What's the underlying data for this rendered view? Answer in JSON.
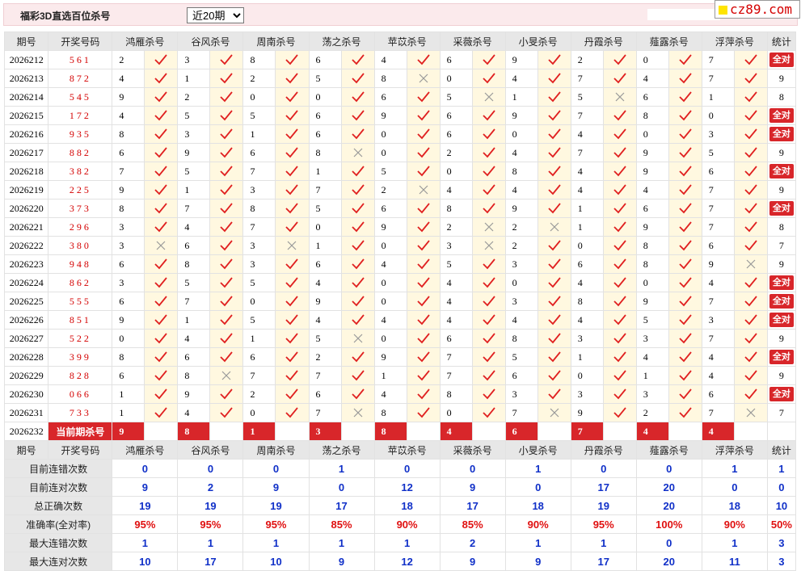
{
  "header": {
    "title": "福彩3D直选百位杀号",
    "range_selected": "近20期",
    "logo_text": "cz89.com"
  },
  "columns": {
    "period": "期号",
    "numbers": "开奖号码",
    "experts": [
      "鸿雁杀号",
      "谷风杀号",
      "周南杀号",
      "荡之杀号",
      "苹苡杀号",
      "采薇杀号",
      "小旻杀号",
      "丹霞杀号",
      "薤露杀号",
      "浮萍杀号"
    ],
    "stats": "统计"
  },
  "rows": [
    {
      "period": "2026212",
      "numbers": "561",
      "values": [
        "2",
        "3",
        "8",
        "6",
        "4",
        "6",
        "9",
        "2",
        "0",
        "7"
      ],
      "marks": [
        1,
        1,
        1,
        1,
        1,
        1,
        1,
        1,
        1,
        1
      ],
      "stat": "全对"
    },
    {
      "period": "2026213",
      "numbers": "872",
      "values": [
        "4",
        "1",
        "2",
        "5",
        "8",
        "0",
        "4",
        "7",
        "4",
        "7"
      ],
      "marks": [
        1,
        1,
        1,
        1,
        0,
        1,
        1,
        1,
        1,
        1
      ],
      "stat": "9"
    },
    {
      "period": "2026214",
      "numbers": "545",
      "values": [
        "9",
        "2",
        "0",
        "0",
        "6",
        "5",
        "1",
        "5",
        "6",
        "1"
      ],
      "marks": [
        1,
        1,
        1,
        1,
        1,
        0,
        1,
        0,
        1,
        1
      ],
      "stat": "8"
    },
    {
      "period": "2026215",
      "numbers": "172",
      "values": [
        "4",
        "5",
        "5",
        "6",
        "9",
        "6",
        "9",
        "7",
        "8",
        "0"
      ],
      "marks": [
        1,
        1,
        1,
        1,
        1,
        1,
        1,
        1,
        1,
        1
      ],
      "stat": "全对"
    },
    {
      "period": "2026216",
      "numbers": "935",
      "values": [
        "8",
        "3",
        "1",
        "6",
        "0",
        "6",
        "0",
        "4",
        "0",
        "3"
      ],
      "marks": [
        1,
        1,
        1,
        1,
        1,
        1,
        1,
        1,
        1,
        1
      ],
      "stat": "全对"
    },
    {
      "period": "2026217",
      "numbers": "882",
      "values": [
        "6",
        "9",
        "6",
        "8",
        "0",
        "2",
        "4",
        "7",
        "9",
        "5"
      ],
      "marks": [
        1,
        1,
        1,
        0,
        1,
        1,
        1,
        1,
        1,
        1
      ],
      "stat": "9"
    },
    {
      "period": "2026218",
      "numbers": "382",
      "values": [
        "7",
        "5",
        "7",
        "1",
        "5",
        "0",
        "8",
        "4",
        "9",
        "6"
      ],
      "marks": [
        1,
        1,
        1,
        1,
        1,
        1,
        1,
        1,
        1,
        1
      ],
      "stat": "全对"
    },
    {
      "period": "2026219",
      "numbers": "225",
      "values": [
        "9",
        "1",
        "3",
        "7",
        "2",
        "4",
        "4",
        "4",
        "4",
        "7"
      ],
      "marks": [
        1,
        1,
        1,
        1,
        0,
        1,
        1,
        1,
        1,
        1
      ],
      "stat": "9"
    },
    {
      "period": "2026220",
      "numbers": "373",
      "values": [
        "8",
        "7",
        "8",
        "5",
        "6",
        "8",
        "9",
        "1",
        "6",
        "7"
      ],
      "marks": [
        1,
        1,
        1,
        1,
        1,
        1,
        1,
        1,
        1,
        1
      ],
      "stat": "全对"
    },
    {
      "period": "2026221",
      "numbers": "296",
      "values": [
        "3",
        "4",
        "7",
        "0",
        "9",
        "2",
        "2",
        "1",
        "9",
        "7"
      ],
      "marks": [
        1,
        1,
        1,
        1,
        1,
        0,
        0,
        1,
        1,
        1
      ],
      "stat": "8"
    },
    {
      "period": "2026222",
      "numbers": "380",
      "values": [
        "3",
        "6",
        "3",
        "1",
        "0",
        "3",
        "2",
        "0",
        "8",
        "6"
      ],
      "marks": [
        0,
        1,
        0,
        1,
        1,
        0,
        1,
        1,
        1,
        1
      ],
      "stat": "7"
    },
    {
      "period": "2026223",
      "numbers": "948",
      "values": [
        "6",
        "8",
        "3",
        "6",
        "4",
        "5",
        "3",
        "6",
        "8",
        "9"
      ],
      "marks": [
        1,
        1,
        1,
        1,
        1,
        1,
        1,
        1,
        1,
        0
      ],
      "stat": "9"
    },
    {
      "period": "2026224",
      "numbers": "862",
      "values": [
        "3",
        "5",
        "5",
        "4",
        "0",
        "4",
        "0",
        "4",
        "0",
        "4"
      ],
      "marks": [
        1,
        1,
        1,
        1,
        1,
        1,
        1,
        1,
        1,
        1
      ],
      "stat": "全对"
    },
    {
      "period": "2026225",
      "numbers": "555",
      "values": [
        "6",
        "7",
        "0",
        "9",
        "0",
        "4",
        "3",
        "8",
        "9",
        "7"
      ],
      "marks": [
        1,
        1,
        1,
        1,
        1,
        1,
        1,
        1,
        1,
        1
      ],
      "stat": "全对"
    },
    {
      "period": "2026226",
      "numbers": "851",
      "values": [
        "9",
        "1",
        "5",
        "4",
        "4",
        "4",
        "4",
        "4",
        "5",
        "3"
      ],
      "marks": [
        1,
        1,
        1,
        1,
        1,
        1,
        1,
        1,
        1,
        1
      ],
      "stat": "全对"
    },
    {
      "period": "2026227",
      "numbers": "522",
      "values": [
        "0",
        "4",
        "1",
        "5",
        "0",
        "6",
        "8",
        "3",
        "3",
        "7"
      ],
      "marks": [
        1,
        1,
        1,
        0,
        1,
        1,
        1,
        1,
        1,
        1
      ],
      "stat": "9"
    },
    {
      "period": "2026228",
      "numbers": "399",
      "values": [
        "8",
        "6",
        "6",
        "2",
        "9",
        "7",
        "5",
        "1",
        "4",
        "4"
      ],
      "marks": [
        1,
        1,
        1,
        1,
        1,
        1,
        1,
        1,
        1,
        1
      ],
      "stat": "全对"
    },
    {
      "period": "2026229",
      "numbers": "828",
      "values": [
        "6",
        "8",
        "7",
        "7",
        "1",
        "7",
        "6",
        "0",
        "1",
        "4"
      ],
      "marks": [
        1,
        0,
        1,
        1,
        1,
        1,
        1,
        1,
        1,
        1
      ],
      "stat": "9"
    },
    {
      "period": "2026230",
      "numbers": "066",
      "values": [
        "1",
        "9",
        "2",
        "6",
        "4",
        "8",
        "3",
        "3",
        "3",
        "6"
      ],
      "marks": [
        1,
        1,
        1,
        1,
        1,
        1,
        1,
        1,
        1,
        1
      ],
      "stat": "全对"
    },
    {
      "period": "2026231",
      "numbers": "733",
      "values": [
        "1",
        "4",
        "0",
        "7",
        "8",
        "0",
        "7",
        "9",
        "2",
        "7"
      ],
      "marks": [
        1,
        1,
        1,
        0,
        1,
        1,
        0,
        1,
        1,
        0
      ],
      "stat": "7"
    }
  ],
  "current": {
    "period": "2026232",
    "label": "当前期杀号",
    "values": [
      "9",
      "8",
      "1",
      "3",
      "8",
      "4",
      "6",
      "7",
      "4",
      "4"
    ]
  },
  "summary": [
    {
      "label": "目前连错次数",
      "values": [
        "0",
        "0",
        "0",
        "1",
        "0",
        "0",
        "1",
        "0",
        "0",
        "1"
      ],
      "stat": "1",
      "color": "blue"
    },
    {
      "label": "目前连对次数",
      "values": [
        "9",
        "2",
        "9",
        "0",
        "12",
        "9",
        "0",
        "17",
        "20",
        "0"
      ],
      "stat": "0",
      "color": "blue"
    },
    {
      "label": "总正确次数",
      "values": [
        "19",
        "19",
        "19",
        "17",
        "18",
        "17",
        "18",
        "19",
        "20",
        "18"
      ],
      "stat": "10",
      "color": "blue"
    },
    {
      "label": "准确率(全对率)",
      "values": [
        "95%",
        "95%",
        "95%",
        "85%",
        "90%",
        "85%",
        "90%",
        "95%",
        "100%",
        "90%"
      ],
      "stat": "50%",
      "color": "red"
    },
    {
      "label": "最大连错次数",
      "values": [
        "1",
        "1",
        "1",
        "1",
        "1",
        "2",
        "1",
        "1",
        "0",
        "1"
      ],
      "stat": "3",
      "color": "blue"
    },
    {
      "label": "最大连对次数",
      "values": [
        "10",
        "17",
        "10",
        "9",
        "12",
        "9",
        "9",
        "17",
        "20",
        "11"
      ],
      "stat": "3",
      "color": "blue"
    }
  ],
  "colors": {
    "accent": "#d8262a",
    "hit": "#e02020",
    "miss": "#999999",
    "summary_value": "#1030c8",
    "header_bg": "#e7e7e7",
    "mark_bg": "#fff8e0"
  }
}
